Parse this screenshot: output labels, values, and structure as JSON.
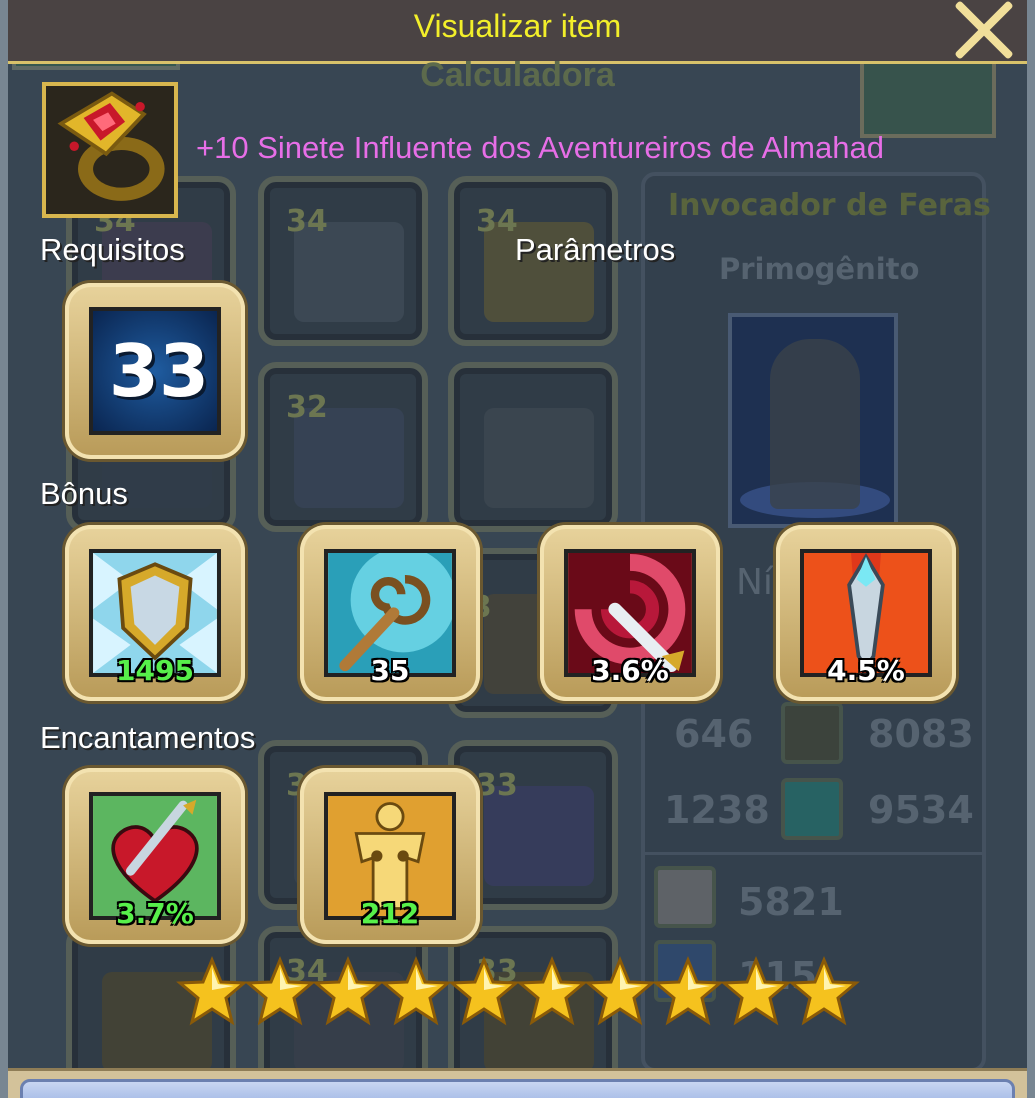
{
  "dialog": {
    "title": "Visualizar item",
    "background_title": "Calculadora"
  },
  "item": {
    "name": "+10 Sinete Influente dos Aventureiros de Almahad",
    "icon": "ruby-ring-icon"
  },
  "sections": {
    "requirements": "Requisitos",
    "parameters": "Parâmetros",
    "bonus": "Bônus",
    "enchantments": "Encantamentos"
  },
  "requirement": {
    "level": "33"
  },
  "bonus": [
    {
      "icon": "shield-defense-icon",
      "value": "1495",
      "color": "green"
    },
    {
      "icon": "magic-staff-icon",
      "value": "35",
      "color": "white"
    },
    {
      "icon": "crit-swirl-sword-icon",
      "value": "3.6%",
      "color": "white"
    },
    {
      "icon": "spike-attack-icon",
      "value": "4.5%",
      "color": "white"
    }
  ],
  "enchantments": [
    {
      "icon": "heart-pierce-icon",
      "value": "3.7%",
      "color": "green"
    },
    {
      "icon": "body-figure-icon",
      "value": "212",
      "color": "green"
    }
  ],
  "stars": {
    "count": 10,
    "filled": 10
  },
  "background": {
    "slot_levels": [
      "34",
      "34",
      "34",
      "32",
      "32",
      "33",
      "33",
      "33",
      "34",
      "33"
    ],
    "class_name": "Invocador de Feras",
    "rank": "Primogênito",
    "level_label": "Nív",
    "stats": [
      "646",
      "8083",
      "1238",
      "9534",
      "5821",
      "115"
    ]
  },
  "colors": {
    "title": "#f2ef2a",
    "item_name": "#e76ee7",
    "green_value": "#57f04a",
    "frame_gold": "#d8b64e"
  }
}
